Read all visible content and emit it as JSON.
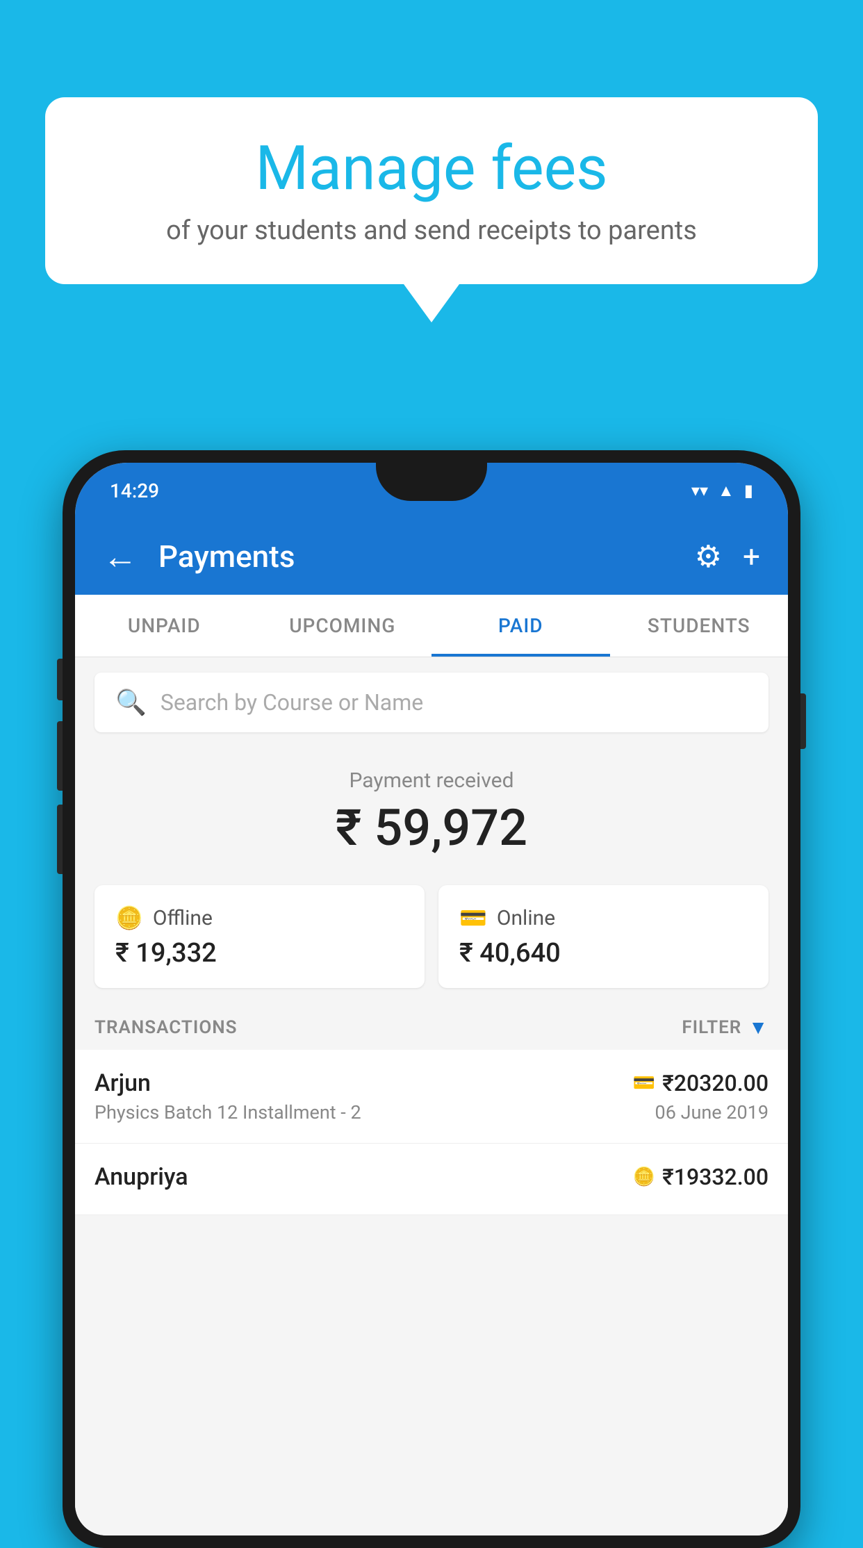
{
  "background_color": "#1ab8e8",
  "bubble": {
    "title": "Manage fees",
    "subtitle": "of your students and send receipts to parents"
  },
  "phone": {
    "status_time": "14:29",
    "app_bar": {
      "title": "Payments",
      "back_label": "←",
      "settings_label": "⚙",
      "add_label": "+"
    },
    "tabs": [
      {
        "label": "UNPAID",
        "active": false
      },
      {
        "label": "UPCOMING",
        "active": false
      },
      {
        "label": "PAID",
        "active": true
      },
      {
        "label": "STUDENTS",
        "active": false
      }
    ],
    "search": {
      "placeholder": "Search by Course or Name"
    },
    "payment_summary": {
      "label": "Payment received",
      "amount": "₹ 59,972",
      "offline_label": "Offline",
      "offline_amount": "₹ 19,332",
      "online_label": "Online",
      "online_amount": "₹ 40,640"
    },
    "transactions": {
      "header": "TRANSACTIONS",
      "filter_label": "FILTER",
      "items": [
        {
          "name": "Arjun",
          "amount": "₹20320.00",
          "detail": "Physics Batch 12 Installment - 2",
          "date": "06 June 2019",
          "payment_type": "card"
        },
        {
          "name": "Anupriya",
          "amount": "₹19332.00",
          "detail": "",
          "date": "",
          "payment_type": "cash"
        }
      ]
    }
  }
}
